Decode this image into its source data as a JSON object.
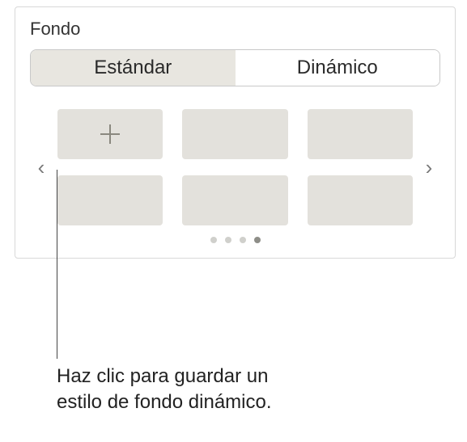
{
  "panel": {
    "title": "Fondo"
  },
  "segmented": {
    "tabs": [
      {
        "label": "Estándar",
        "active": false
      },
      {
        "label": "Dinámico",
        "active": true
      }
    ]
  },
  "thumbnails": {
    "items": [
      {
        "kind": "add"
      },
      {
        "kind": "preset"
      },
      {
        "kind": "preset"
      },
      {
        "kind": "preset"
      },
      {
        "kind": "preset"
      },
      {
        "kind": "preset"
      }
    ]
  },
  "pagination": {
    "count": 4,
    "active_index": 3
  },
  "icons": {
    "chevron_left": "‹",
    "chevron_right": "›"
  },
  "callout": {
    "line1": "Haz clic para guardar un",
    "line2": "estilo de fondo dinámico."
  }
}
